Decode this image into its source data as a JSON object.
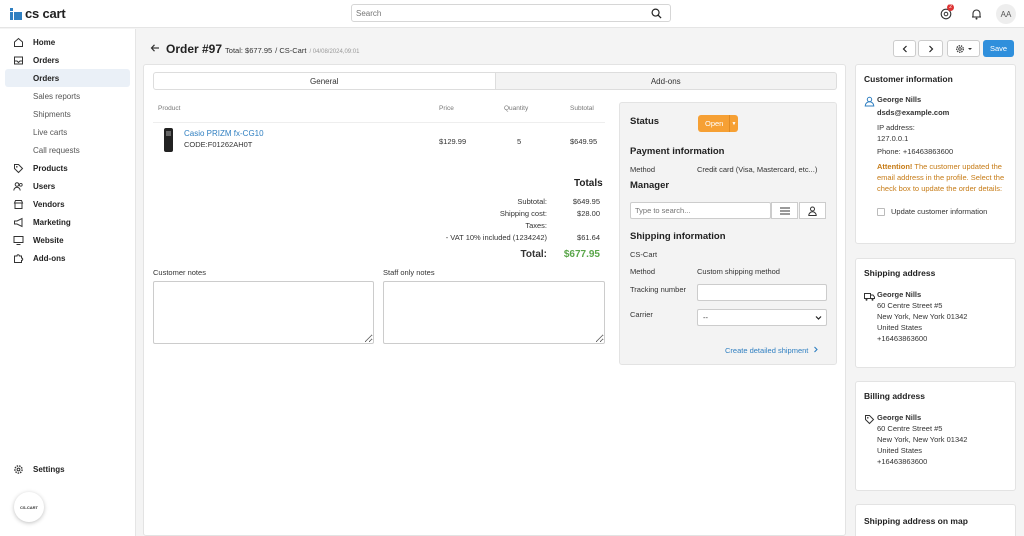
{
  "app": {
    "logo": "cs cart"
  },
  "search": {
    "placeholder": "Search"
  },
  "topbar": {
    "notifications_count": "2",
    "avatar_initials": "AA"
  },
  "sidebar": {
    "items": [
      {
        "label": "Home"
      },
      {
        "label": "Orders"
      },
      {
        "label": "Products"
      },
      {
        "label": "Users"
      },
      {
        "label": "Vendors"
      },
      {
        "label": "Marketing"
      },
      {
        "label": "Website"
      },
      {
        "label": "Add-ons"
      }
    ],
    "orders_sub": [
      "Orders",
      "Sales reports",
      "Shipments",
      "Live carts",
      "Call requests"
    ],
    "settings": "Settings",
    "bubble_text": "CS-CART"
  },
  "header": {
    "title": "Order #97",
    "total": "Total: $677.95",
    "store": "/ CS-Cart",
    "date": "/ 04/08/2024,09:01",
    "save_label": "Save"
  },
  "tabs": [
    "General",
    "Add-ons"
  ],
  "products": {
    "headers": {
      "product": "Product",
      "price": "Price",
      "quantity": "Quantity",
      "subtotal": "Subtotal"
    },
    "rows": [
      {
        "name": "Casio PRIZM fx-CG10",
        "code": "CODE:F01262AH0T",
        "price": "$129.99",
        "quantity": "5",
        "subtotal": "$649.95"
      }
    ]
  },
  "totals": {
    "title": "Totals",
    "subtotal_label": "Subtotal:",
    "subtotal_value": "$649.95",
    "shipping_label": "Shipping cost:",
    "shipping_value": "$28.00",
    "taxes_label": "Taxes:",
    "vat_label": "- VAT 10% included (1234242)",
    "vat_value": "$61.64",
    "total_label": "Total:",
    "total_value": "$677.95"
  },
  "notes": {
    "customer": "Customer notes",
    "staff": "Staff only notes"
  },
  "status_panel": {
    "status_title": "Status",
    "status_value": "Open",
    "payment_title": "Payment information",
    "method_label": "Method",
    "payment_method": "Credit card (Visa, Mastercard, etc...)",
    "manager_title": "Manager",
    "manager_placeholder": "Type to search...",
    "shipping_title": "Shipping information",
    "shipping_store": "CS-Cart",
    "shipping_method_label": "Method",
    "shipping_method": "Custom shipping method",
    "tracking_label": "Tracking number",
    "carrier_label": "Carrier",
    "carrier_value": "--",
    "create_shipment": "Create detailed shipment"
  },
  "customer": {
    "title": "Customer information",
    "name": "George Nills",
    "email": "dsds@example.com",
    "ip_label": "IP address:",
    "ip": "127.0.0.1",
    "phone": "Phone: +16463863600",
    "attention": "Attention!",
    "attention_text": "The customer updated the email address in the profile. Select the check box to update the order details:",
    "update_label": "Update customer information"
  },
  "shipping_address": {
    "title": "Shipping address",
    "name": "George Nills",
    "street": "60 Centre Street #5",
    "city": "New York, New York 01342",
    "country": "United States",
    "phone": "+16463863600"
  },
  "billing_address": {
    "title": "Billing address",
    "name": "George Nills",
    "street": "60 Centre Street #5",
    "city": "New York, New York 01342",
    "country": "United States",
    "phone": "+16463863600"
  },
  "map_card": {
    "title": "Shipping address on map"
  },
  "colors": {
    "accent": "#2f7fc1",
    "save": "#2f8fdc",
    "open": "#f6a034",
    "total": "#5aa64a",
    "warn": "#c67b16"
  }
}
